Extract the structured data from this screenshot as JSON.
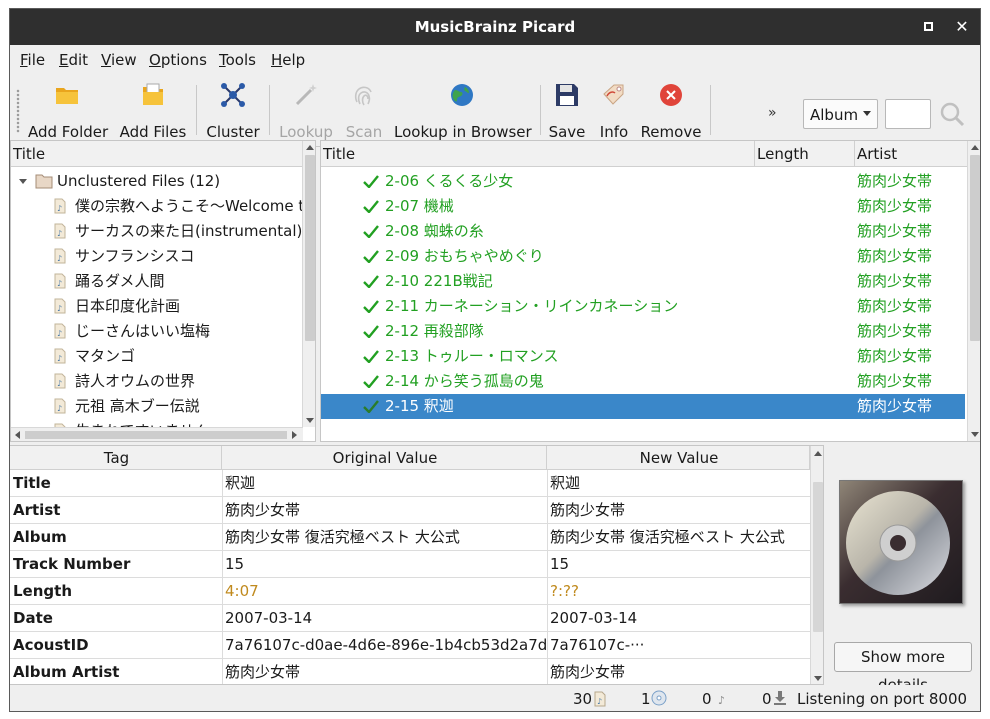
{
  "window": {
    "title": "MusicBrainz Picard",
    "close_glyph": "✕"
  },
  "menu": [
    "File",
    "Edit",
    "View",
    "Options",
    "Tools",
    "Help"
  ],
  "toolbar": {
    "buttons": [
      {
        "label": "Add Folder",
        "icon": "folder-icon"
      },
      {
        "label": "Add Files",
        "icon": "files-icon"
      },
      {
        "label": "Cluster",
        "icon": "cluster-icon"
      },
      {
        "label": "Lookup",
        "icon": "lookup-wand-icon",
        "disabled": true
      },
      {
        "label": "Scan",
        "icon": "fingerprint-icon",
        "disabled": true
      },
      {
        "label": "Lookup in Browser",
        "icon": "globe-icon"
      },
      {
        "label": "Save",
        "icon": "save-icon"
      },
      {
        "label": "Info",
        "icon": "info-tag-icon"
      },
      {
        "label": "Remove",
        "icon": "remove-icon"
      }
    ],
    "more": "»",
    "search_type": "Album",
    "search_value": ""
  },
  "left_pane": {
    "header": "Title",
    "cluster_label": "Unclustered Files (12)",
    "files": [
      "僕の宗教へようこそ〜Welcome to",
      "サーカスの来た日(instrumental)",
      "サンフランシスコ",
      "踊るダメ人間",
      "日本印度化計画",
      "じーさんはいい塩梅",
      "マタンゴ",
      "詩人オウムの世界",
      "元祖 高木ブー伝説",
      "生まれてすいません"
    ]
  },
  "right_pane": {
    "headers": {
      "title": "Title",
      "length": "Length",
      "artist": "Artist"
    },
    "tracks": [
      {
        "title": "2-06  くるくる少女",
        "artist": "筋肉少女帯"
      },
      {
        "title": "2-07  機械",
        "artist": "筋肉少女帯"
      },
      {
        "title": "2-08  蜘蛛の糸",
        "artist": "筋肉少女帯"
      },
      {
        "title": "2-09  おもちゃやめぐり",
        "artist": "筋肉少女帯"
      },
      {
        "title": "2-10  221B戦記",
        "artist": "筋肉少女帯"
      },
      {
        "title": "2-11  カーネーション・リインカネーション",
        "artist": "筋肉少女帯"
      },
      {
        "title": "2-12  再殺部隊",
        "artist": "筋肉少女帯"
      },
      {
        "title": "2-13  トゥルー・ロマンス",
        "artist": "筋肉少女帯"
      },
      {
        "title": "2-14  から笑う孤島の鬼",
        "artist": "筋肉少女帯"
      },
      {
        "title": "2-15  釈迦",
        "artist": "筋肉少女帯",
        "selected": true
      }
    ]
  },
  "metadata": {
    "headers": {
      "tag": "Tag",
      "original": "Original Value",
      "new": "New Value"
    },
    "rows": [
      {
        "tag": "Title",
        "original": "釈迦",
        "new": "釈迦"
      },
      {
        "tag": "Artist",
        "original": "筋肉少女帯",
        "new": "筋肉少女帯"
      },
      {
        "tag": "Album",
        "original": "筋肉少女帯 復活究極ベスト 大公式",
        "new": "筋肉少女帯 復活究極ベスト 大公式"
      },
      {
        "tag": "Track Number",
        "original": "15",
        "new": "15"
      },
      {
        "tag": "Length",
        "original": "4:07",
        "new": "?:??",
        "highlight": true
      },
      {
        "tag": "Date",
        "original": "2007-03-14",
        "new": "2007-03-14"
      },
      {
        "tag": "AcoustID",
        "original": "7a76107c-d0ae-4d6e-896e-1b4cb53d2a7d",
        "new": "7a76107c-···"
      },
      {
        "tag": "Album Artist",
        "original": "筋肉少女帯",
        "new": "筋肉少女帯"
      }
    ]
  },
  "details_button": "Show more details",
  "status": {
    "files": "30",
    "albums": "1",
    "pending_files": "0",
    "pending_requests": "0",
    "message": "Listening on port 8000"
  },
  "colors": {
    "matched_green": "#22a022",
    "selection_blue": "#3a87c9",
    "highlight_orange": "#c08a1e"
  }
}
